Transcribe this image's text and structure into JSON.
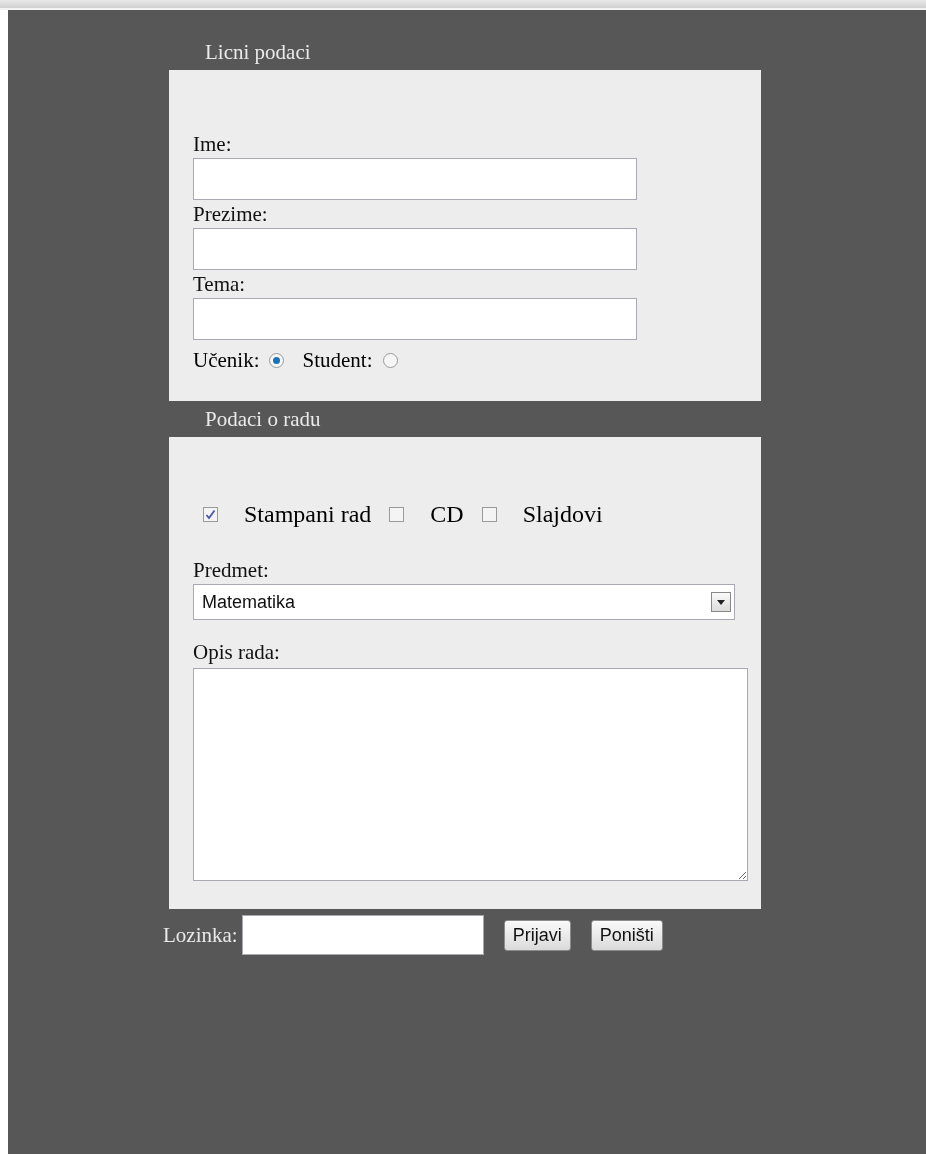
{
  "sections": [
    {
      "legend": "Licni podaci",
      "fields": [
        {
          "kind": "text",
          "label": "Ime:"
        },
        {
          "kind": "text",
          "label": "Prezime:"
        },
        {
          "kind": "text",
          "label": "Tema:"
        }
      ],
      "radios": [
        {
          "label": "Učenik:",
          "selected": true
        },
        {
          "label": "Student:",
          "selected": false
        }
      ]
    },
    {
      "legend": "Podaci o radu",
      "checkboxes": [
        {
          "label": "Stampani rad",
          "checked": true
        },
        {
          "label": "CD",
          "checked": false
        },
        {
          "label": "Slajdovi",
          "checked": false
        }
      ],
      "select": {
        "label": "Predmet:",
        "value": "Matematika"
      },
      "textarea": {
        "label": "Opis rada:"
      }
    }
  ],
  "password": {
    "label": "Lozinka:"
  },
  "buttons": [
    "Prijavi",
    "Poništi"
  ]
}
